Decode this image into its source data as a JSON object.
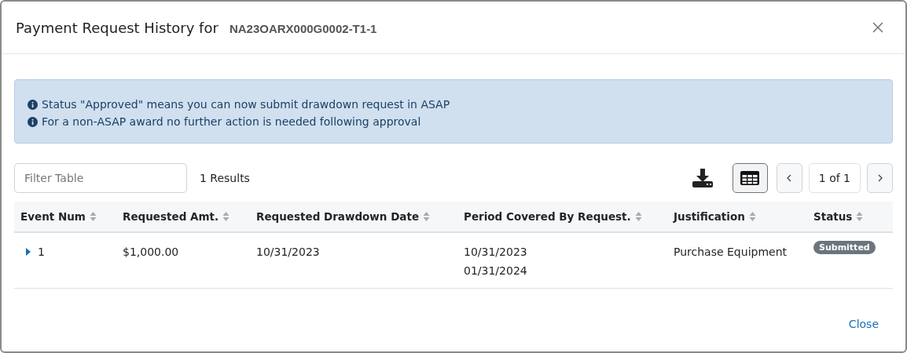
{
  "modal": {
    "title": "Payment Request History for",
    "award_id": "NA23OARX000G0002-T1-1"
  },
  "alerts": [
    "Status \"Approved\" means you can now submit drawdown request in ASAP",
    "For a non-ASAP award no further action is needed following approval"
  ],
  "filter": {
    "placeholder": "Filter Table"
  },
  "results": "1 Results",
  "pagination": {
    "page": "1 of 1"
  },
  "table": {
    "columns": [
      "Event Num",
      "Requested Amt.",
      "Requested Drawdown Date",
      "Period Covered By Request.",
      "Justification",
      "Status"
    ],
    "rows": [
      {
        "expanded": false,
        "event_num": "1",
        "amount": "$1,000.00",
        "drawdown_date": "10/31/2023",
        "period": [
          "10/31/2023",
          "01/31/2024"
        ],
        "justification": "Purchase Equipment",
        "status": "Submitted"
      }
    ]
  },
  "footer": {
    "close": "Close"
  }
}
